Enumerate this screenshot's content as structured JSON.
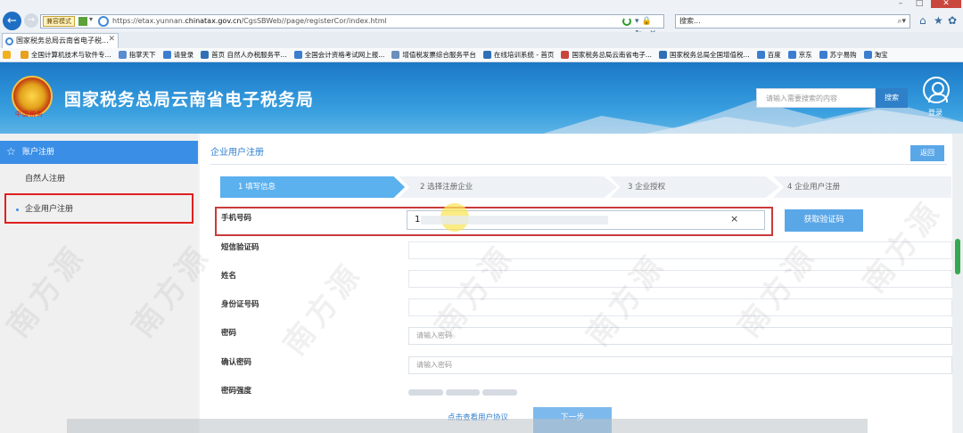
{
  "browser": {
    "mode_badge": "兼容模式",
    "url_prefix": "https://etax.yunnan.",
    "url_domain": "chinatax.gov.cn",
    "url_suffix": "/CgsSBWeb//page/registerCor/index.html",
    "search_text": "搜索...",
    "tab_title": "国家税务总局云南省电子税...",
    "favorites": [
      {
        "label": "全国计算机技术与软件专...",
        "color": "#e8a11c"
      },
      {
        "label": "指掌天下",
        "color": "#5b8bd0"
      },
      {
        "label": "请登录",
        "color": "#3b7ed0"
      },
      {
        "label": "首页 自然人办税服务平...",
        "color": "#2f6fb5"
      },
      {
        "label": "全国会计资格考试网上报...",
        "color": "#3b7ed0"
      },
      {
        "label": "增值税发票综合服务平台",
        "color": "#6a8fb8"
      },
      {
        "label": "在线培训系统 - 首页",
        "color": "#2f6fb5"
      },
      {
        "label": "国家税务总局云南省电子...",
        "color": "#c9463d"
      },
      {
        "label": "国家税务总局全国增值税...",
        "color": "#2f6fb5"
      },
      {
        "label": "百度",
        "color": "#3b7ed0"
      },
      {
        "label": "京东",
        "color": "#3b7ed0"
      },
      {
        "label": "苏宁易购",
        "color": "#3b7ed0"
      },
      {
        "label": "淘宝",
        "color": "#3b7ed0"
      }
    ]
  },
  "site": {
    "title": "国家税务总局云南省电子税务局",
    "emblem_caption": "中国税务",
    "search_placeholder": "请输入需要搜索的内容",
    "search_button": "搜索",
    "login": "登录"
  },
  "sidebar": {
    "title": "账户注册",
    "items": [
      {
        "label": "自然人注册"
      },
      {
        "label": "企业用户注册"
      }
    ]
  },
  "main": {
    "title": "企业用户注册",
    "back": "返回",
    "steps": [
      "1 填写信息",
      "2 选择注册企业",
      "3 企业授权",
      "4 企业用户注册"
    ],
    "active_step": 1,
    "fields": {
      "phone_label": "手机号码",
      "phone_value": "1",
      "sms_label": "短信验证码",
      "name_label": "姓名",
      "id_label": "身份证号码",
      "password_label": "密码",
      "password_placeholder": "请输入密码",
      "confirm_label": "确认密码",
      "confirm_placeholder": "请输入密码",
      "strength_label": "密码强度"
    },
    "sms_button": "获取验证码",
    "agreement_link": "点击查看用户协议",
    "next_button": "下一步"
  },
  "watermark": "南方源",
  "colors": {
    "accent": "#3a8ee6",
    "highlight_border": "#e01f1f",
    "banner": "#2b8fd6"
  }
}
